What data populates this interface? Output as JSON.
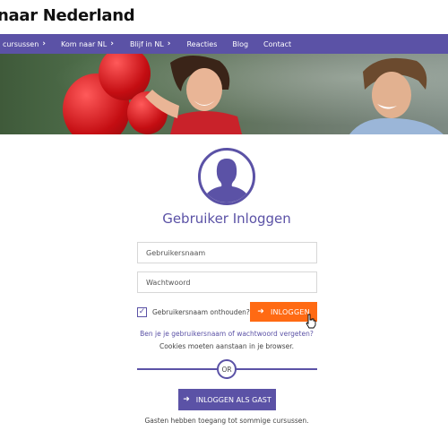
{
  "site": {
    "title": "naar Nederland"
  },
  "nav": {
    "items": [
      {
        "label": "Mijn cursussen",
        "has_chevron": true
      },
      {
        "label": "Kom naar NL",
        "has_chevron": true
      },
      {
        "label": "Blijf in NL",
        "has_chevron": true
      },
      {
        "label": "Reacties",
        "has_chevron": false
      },
      {
        "label": "Blog",
        "has_chevron": false
      },
      {
        "label": "Contact",
        "has_chevron": false
      }
    ]
  },
  "login": {
    "title": "Gebruiker Inloggen",
    "username_placeholder": "Gebruikersnaam",
    "username_value": "",
    "password_placeholder": "Wachtwoord",
    "password_value": "",
    "remember_label": "Gebruikersnaam onthouden?",
    "remember_checked": true,
    "login_button": "INLOGGEN",
    "forgot_link": "Ben je je gebruikersnaam of wachtwoord vergeten?",
    "cookies_note": "Cookies moeten aanstaan in je browser.",
    "or_label": "OR",
    "guest_button": "INLOGGEN ALS GAST",
    "guest_note": "Gasten hebben toegang tot sommige cursussen."
  },
  "icons": {
    "arrow": "arrow-right-icon",
    "chevron": "chevron-right-icon",
    "avatar": "user-silhouette-icon",
    "check": "checkmark-icon",
    "cursor": "hand-pointer-icon"
  },
  "colors": {
    "brand_purple": "#5b52a6",
    "login_orange": "#ff6a13",
    "white": "#ffffff"
  }
}
